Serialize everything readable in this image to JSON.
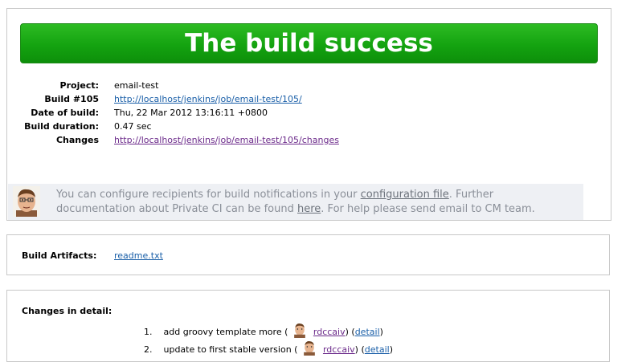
{
  "banner": {
    "title": "The build success"
  },
  "build_info": [
    {
      "label": "Project:",
      "value": "email-test",
      "is_link": false
    },
    {
      "label": "Build #105",
      "value": "http://localhost/jenkins/job/email-test/105/",
      "is_link": true
    },
    {
      "label": "Date of build:",
      "value": "Thu, 22 Mar 2012 13:16:11 +0800",
      "is_link": false
    },
    {
      "label": "Build duration:",
      "value": "0.47 sec",
      "is_link": false
    },
    {
      "label": "Changes",
      "value": "http://localhost/jenkins/job/email-test/105/changes",
      "is_link": true
    }
  ],
  "notice": {
    "text_1": "You can configure recipients for build notifications in your ",
    "link_1": "configuration file",
    "text_2": ". Further documentation about Private CI can be found ",
    "link_2": "here",
    "text_3": ". For help please send email to CM team."
  },
  "artifacts": {
    "label": "Build Artifacts:",
    "file": "readme.txt"
  },
  "changes": {
    "label": "Changes in detail:",
    "items": [
      {
        "num": "1.",
        "message": "add groovy template more (",
        "author": "rdccaiv",
        "close": ")",
        "detail": "detail"
      },
      {
        "num": "2.",
        "message": "update to first stable version (",
        "author": "rdccaiv",
        "close": ")",
        "detail": "detail"
      }
    ]
  },
  "colors": {
    "success_green": "#14a310",
    "link_blue": "#1a5fa8",
    "visited_purple": "#6b2a8a"
  }
}
